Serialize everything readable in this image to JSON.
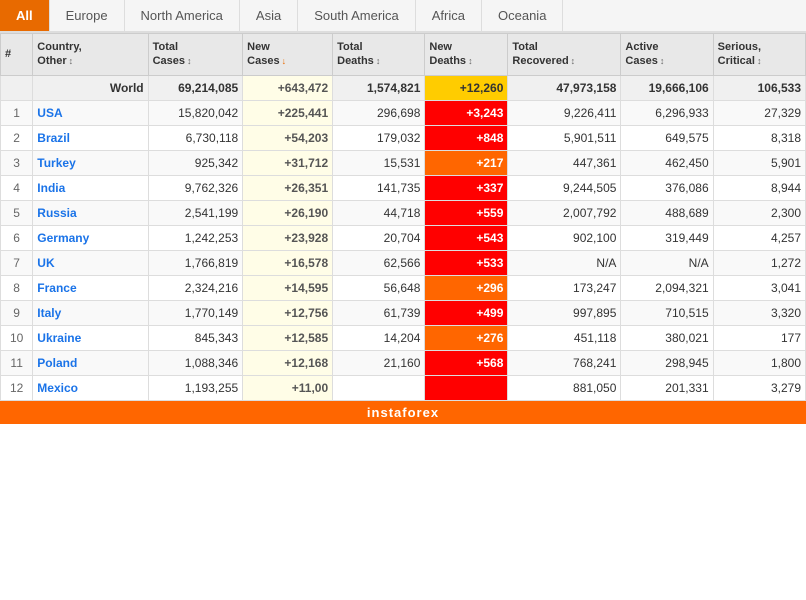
{
  "tabs": [
    {
      "label": "All",
      "active": true
    },
    {
      "label": "Europe",
      "active": false
    },
    {
      "label": "North America",
      "active": false
    },
    {
      "label": "Asia",
      "active": false
    },
    {
      "label": "South America",
      "active": false
    },
    {
      "label": "Africa",
      "active": false
    },
    {
      "label": "Oceania",
      "active": false
    }
  ],
  "columns": [
    {
      "label": "#",
      "sub": "",
      "sortable": false
    },
    {
      "label": "Country,",
      "sub": "Other",
      "sortable": true
    },
    {
      "label": "Total",
      "sub": "Cases",
      "sortable": true
    },
    {
      "label": "New",
      "sub": "Cases",
      "sortable": true,
      "active_sort": true
    },
    {
      "label": "Total",
      "sub": "Deaths",
      "sortable": true
    },
    {
      "label": "New",
      "sub": "Deaths",
      "sortable": true
    },
    {
      "label": "Total",
      "sub": "Recovered",
      "sortable": true
    },
    {
      "label": "Active",
      "sub": "Cases",
      "sortable": true
    },
    {
      "label": "Serious,",
      "sub": "Critical",
      "sortable": true
    }
  ],
  "world_row": {
    "rank": "",
    "country": "World",
    "total_cases": "69,214,085",
    "new_cases": "+643,472",
    "total_deaths": "1,574,821",
    "new_deaths": "+12,260",
    "total_recovered": "47,973,158",
    "active_cases": "19,666,106",
    "serious": "106,533"
  },
  "rows": [
    {
      "rank": "1",
      "country": "USA",
      "total_cases": "15,820,042",
      "new_cases": "+225,441",
      "total_deaths": "296,698",
      "new_deaths": "+3,243",
      "new_deaths_class": "new-deaths-red",
      "total_recovered": "9,226,411",
      "active_cases": "6,296,933",
      "serious": "27,329"
    },
    {
      "rank": "2",
      "country": "Brazil",
      "total_cases": "6,730,118",
      "new_cases": "+54,203",
      "total_deaths": "179,032",
      "new_deaths": "+848",
      "new_deaths_class": "new-deaths-red",
      "total_recovered": "5,901,511",
      "active_cases": "649,575",
      "serious": "8,318"
    },
    {
      "rank": "3",
      "country": "Turkey",
      "total_cases": "925,342",
      "new_cases": "+31,712",
      "total_deaths": "15,531",
      "new_deaths": "+217",
      "new_deaths_class": "new-deaths-orange",
      "total_recovered": "447,361",
      "active_cases": "462,450",
      "serious": "5,901"
    },
    {
      "rank": "4",
      "country": "India",
      "total_cases": "9,762,326",
      "new_cases": "+26,351",
      "total_deaths": "141,735",
      "new_deaths": "+337",
      "new_deaths_class": "new-deaths-red",
      "total_recovered": "9,244,505",
      "active_cases": "376,086",
      "serious": "8,944"
    },
    {
      "rank": "5",
      "country": "Russia",
      "total_cases": "2,541,199",
      "new_cases": "+26,190",
      "total_deaths": "44,718",
      "new_deaths": "+559",
      "new_deaths_class": "new-deaths-red",
      "total_recovered": "2,007,792",
      "active_cases": "488,689",
      "serious": "2,300"
    },
    {
      "rank": "6",
      "country": "Germany",
      "total_cases": "1,242,253",
      "new_cases": "+23,928",
      "total_deaths": "20,704",
      "new_deaths": "+543",
      "new_deaths_class": "new-deaths-red",
      "total_recovered": "902,100",
      "active_cases": "319,449",
      "serious": "4,257"
    },
    {
      "rank": "7",
      "country": "UK",
      "total_cases": "1,766,819",
      "new_cases": "+16,578",
      "total_deaths": "62,566",
      "new_deaths": "+533",
      "new_deaths_class": "new-deaths-red",
      "total_recovered": "N/A",
      "active_cases": "N/A",
      "serious": "1,272"
    },
    {
      "rank": "8",
      "country": "France",
      "total_cases": "2,324,216",
      "new_cases": "+14,595",
      "total_deaths": "56,648",
      "new_deaths": "+296",
      "new_deaths_class": "new-deaths-orange",
      "total_recovered": "173,247",
      "active_cases": "2,094,321",
      "serious": "3,041"
    },
    {
      "rank": "9",
      "country": "Italy",
      "total_cases": "1,770,149",
      "new_cases": "+12,756",
      "total_deaths": "61,739",
      "new_deaths": "+499",
      "new_deaths_class": "new-deaths-red",
      "total_recovered": "997,895",
      "active_cases": "710,515",
      "serious": "3,320"
    },
    {
      "rank": "10",
      "country": "Ukraine",
      "total_cases": "845,343",
      "new_cases": "+12,585",
      "total_deaths": "14,204",
      "new_deaths": "+276",
      "new_deaths_class": "new-deaths-orange",
      "total_recovered": "451,118",
      "active_cases": "380,021",
      "serious": "177"
    },
    {
      "rank": "11",
      "country": "Poland",
      "total_cases": "1,088,346",
      "new_cases": "+12,168",
      "total_deaths": "21,160",
      "new_deaths": "+568",
      "new_deaths_class": "new-deaths-red",
      "total_recovered": "768,241",
      "active_cases": "298,945",
      "serious": "1,800"
    },
    {
      "rank": "12",
      "country": "Mexico",
      "total_cases": "1,193,255",
      "new_cases": "+11,00",
      "total_deaths": "",
      "new_deaths": "",
      "new_deaths_class": "new-deaths-red",
      "total_recovered": "881,050",
      "active_cases": "201,331",
      "serious": "3,279"
    }
  ],
  "watermark": "instaforex"
}
